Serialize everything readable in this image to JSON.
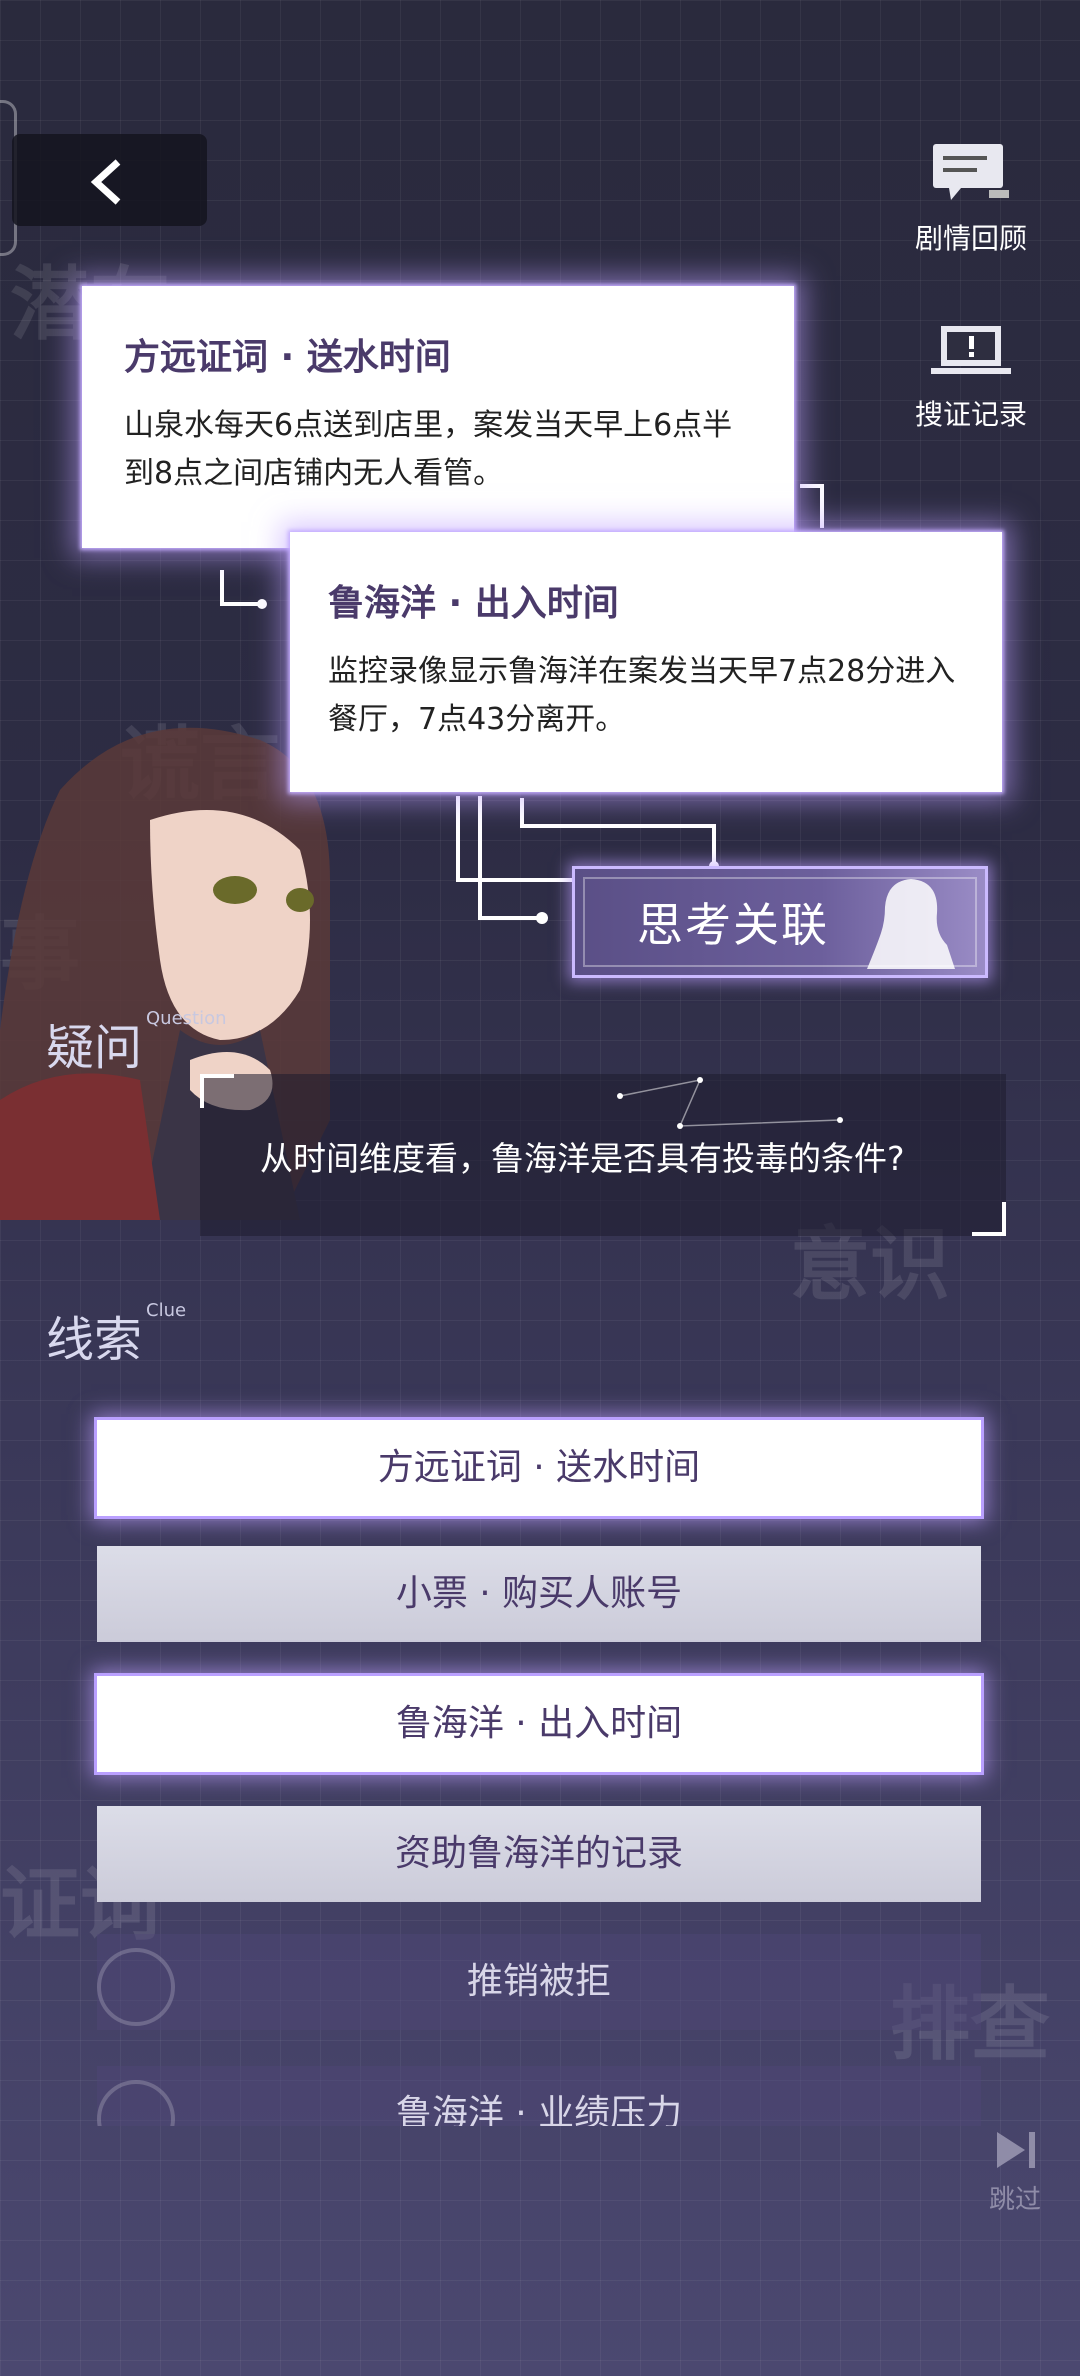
{
  "header": {
    "back_icon": "chevron-left-icon"
  },
  "side": {
    "review_label": "剧情回顾",
    "record_label": "搜证记录"
  },
  "cards": [
    {
      "title": "方远证词 · 送水时间",
      "text": "山泉水每天6点送到店里，案发当天早上6点半到8点之间店铺内无人看管。"
    },
    {
      "title": "鲁海洋 · 出入时间",
      "text": "监控录像显示鲁海洋在案发当天早7点28分进入餐厅，7点43分离开。"
    }
  ],
  "think_button": {
    "label": "思考关联"
  },
  "question": {
    "section": "疑问",
    "section_en": "Question",
    "text": "从时间维度看，鲁海洋是否具有投毒的条件?"
  },
  "clues": {
    "section": "线索",
    "section_en": "Clue",
    "items": [
      {
        "label": "方远证词 · 送水时间",
        "state": "selected"
      },
      {
        "label": "小票 · 购买人账号",
        "state": "normal"
      },
      {
        "label": "鲁海洋 · 出入时间",
        "state": "selected"
      },
      {
        "label": "资助鲁海洋的记录",
        "state": "normal"
      },
      {
        "label": "推销被拒",
        "state": "used"
      },
      {
        "label": "鲁海洋 · 业绩压力",
        "state": "used"
      }
    ]
  },
  "skip": {
    "label": "跳过"
  },
  "colors": {
    "accent": "#b7a0ff",
    "card_title": "#4a3a6a"
  }
}
